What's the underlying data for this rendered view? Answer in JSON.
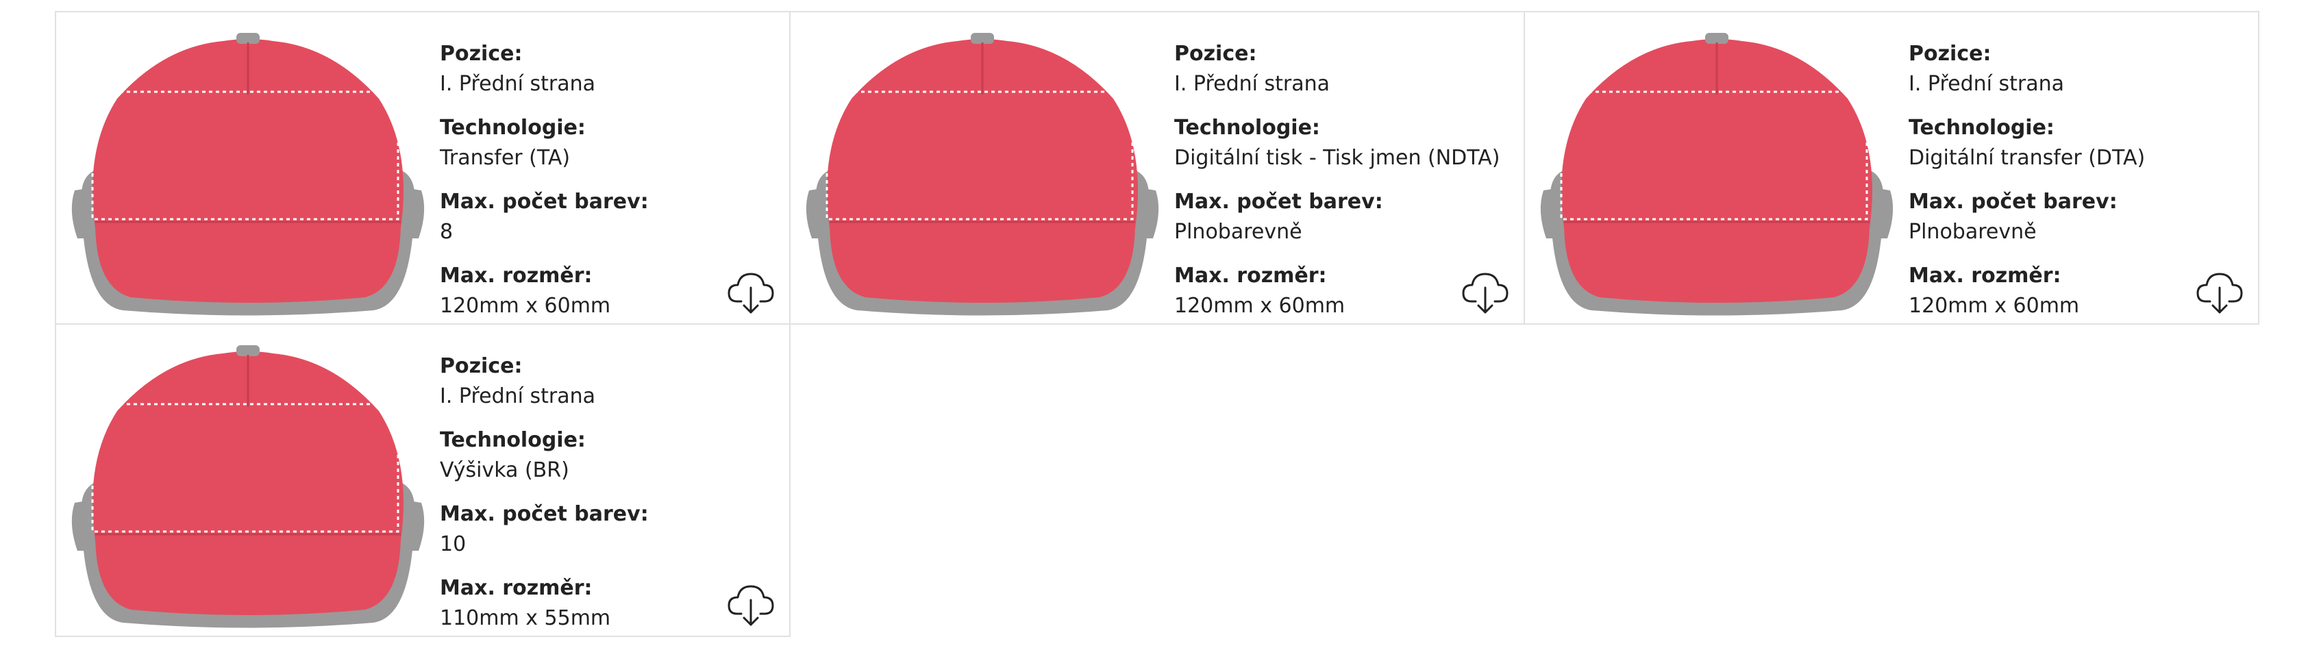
{
  "labels": {
    "position": "Pozice:",
    "technology": "Technologie:",
    "max_colors": "Max. počet barev:",
    "max_size": "Max. rozměr:"
  },
  "colors": {
    "cap_body": "#e34c5e",
    "cap_brim": "#9a9a9a",
    "print_area_outline": "#ffffff",
    "card_border": "#e1e1e1"
  },
  "icons": {
    "download": "cloud-download-icon"
  },
  "cards": [
    {
      "position": "I. Přední strana",
      "technology": "Transfer (TA)",
      "max_colors": "8",
      "max_size": "120mm x 60mm"
    },
    {
      "position": "I. Přední strana",
      "technology": "Digitální tisk - Tisk jmen (NDTA)",
      "max_colors": "Plnobarevně",
      "max_size": "120mm x 60mm"
    },
    {
      "position": "I. Přední strana",
      "technology": "Digitální transfer (DTA)",
      "max_colors": "Plnobarevně",
      "max_size": "120mm x 60mm"
    },
    {
      "position": "I. Přední strana",
      "technology": "Výšivka (BR)",
      "max_colors": "10",
      "max_size": "110mm x 55mm"
    }
  ]
}
